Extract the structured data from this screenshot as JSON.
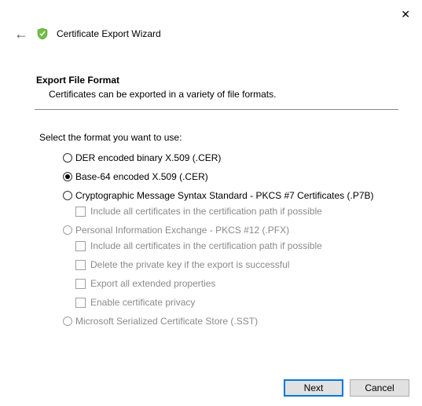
{
  "window": {
    "title": "Certificate Export Wizard"
  },
  "section": {
    "heading": "Export File Format",
    "description": "Certificates can be exported in a variety of file formats."
  },
  "prompt": "Select the format you want to use:",
  "options": {
    "der": "DER encoded binary X.509 (.CER)",
    "base64": "Base-64 encoded X.509 (.CER)",
    "pkcs7": "Cryptographic Message Syntax Standard - PKCS #7 Certificates (.P7B)",
    "pkcs7_sub1": "Include all certificates in the certification path if possible",
    "pfx": "Personal Information Exchange - PKCS #12 (.PFX)",
    "pfx_sub1": "Include all certificates in the certification path if possible",
    "pfx_sub2": "Delete the private key if the export is successful",
    "pfx_sub3": "Export all extended properties",
    "pfx_sub4": "Enable certificate privacy",
    "sst": "Microsoft Serialized Certificate Store (.SST)"
  },
  "buttons": {
    "next": "Next",
    "cancel": "Cancel"
  }
}
